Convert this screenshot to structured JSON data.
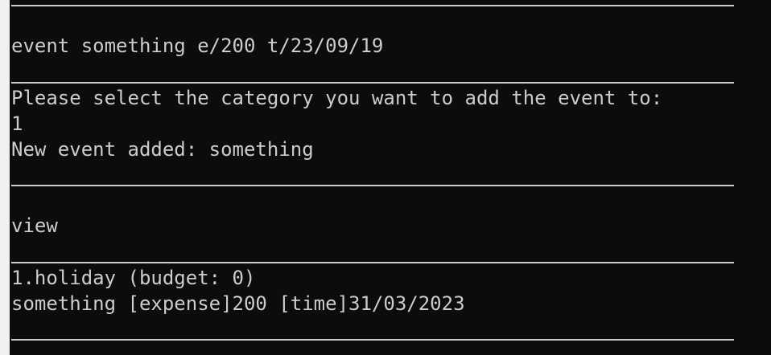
{
  "terminal": {
    "lines": [
      "event something e/200 t/23/09/19",
      "Please select the category you want to add the event to:",
      "1",
      "New event added: something",
      "view",
      "1.holiday (budget: 0)",
      "something [expense]200 [time]31/03/2023"
    ]
  }
}
